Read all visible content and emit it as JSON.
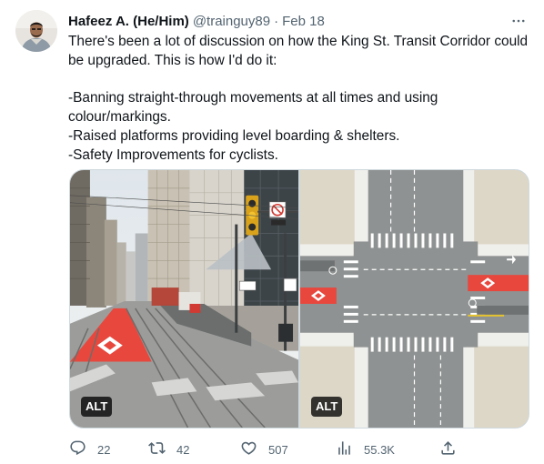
{
  "tweet": {
    "display_name": "Hafeez A. (He/Him)",
    "handle": "@trainguy89",
    "separator": "·",
    "date": "Feb 18",
    "more_icon": "more-dots-icon",
    "text_lines": [
      "There's been a lot of discussion on how the King St. Transit Corridor could be upgraded. This is how I'd do it:",
      "",
      "-Banning straight-through movements at all times and using colour/markings.",
      "-Raised platforms providing level boarding & shelters.",
      "-Safety Improvements for cyclists."
    ],
    "media": [
      {
        "alt_badge": "ALT",
        "description_kind": "street-view rendering"
      },
      {
        "alt_badge": "ALT",
        "description_kind": "aerial intersection rendering"
      }
    ],
    "actions": {
      "replies": "22",
      "retweets": "42",
      "likes": "507",
      "views": "55.3K"
    }
  },
  "colors": {
    "text_primary": "#0f1419",
    "text_secondary": "#536471",
    "border": "#cfd9de",
    "lane_red": "#e8473d"
  }
}
